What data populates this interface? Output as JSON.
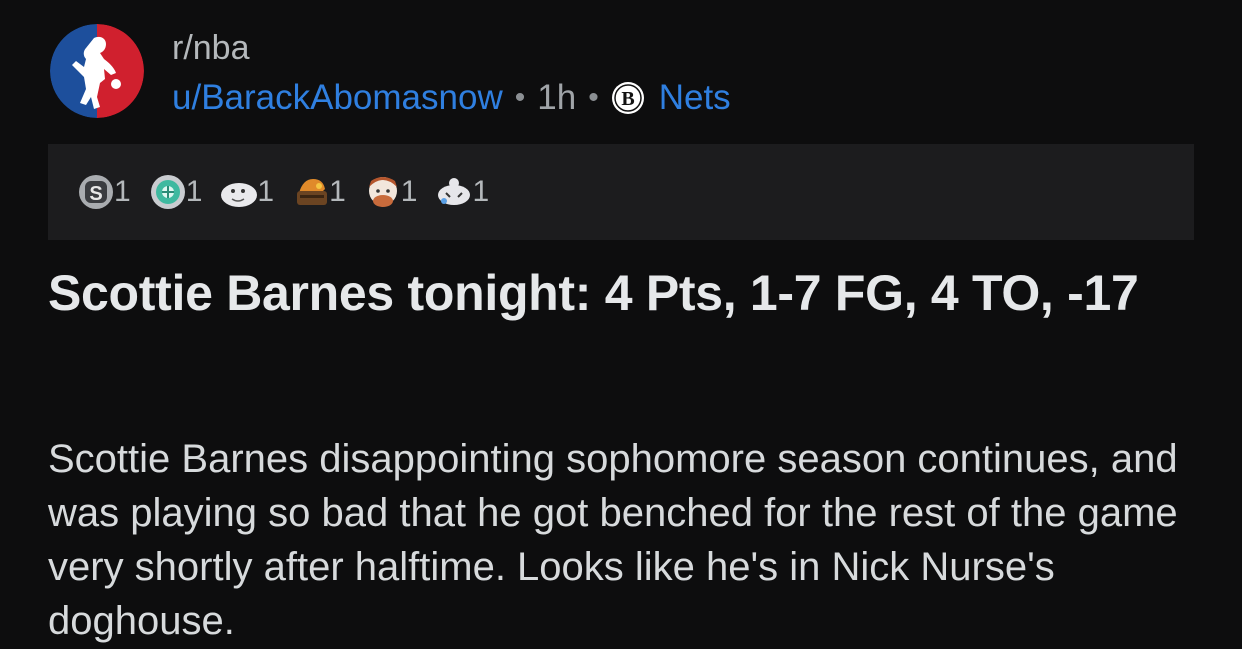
{
  "post": {
    "subreddit": "r/nba",
    "author": "u/BarackAbomasnow",
    "separator": "•",
    "time": "1h",
    "flair": "Nets",
    "title": "Scottie Barnes tonight: 4 Pts, 1-7 FG, 4 TO, -17",
    "body": "Scottie Barnes disappointing sophomore season continues, and was playing so bad that he got benched for the rest of the game very shortly after halftime. Looks like he's in Nick Nurse's doghouse."
  },
  "awards": [
    {
      "icon": "silver-award-icon",
      "count": "1"
    },
    {
      "icon": "helpful-award-icon",
      "count": "1"
    },
    {
      "icon": "upvote-ghost-award-icon",
      "count": "1"
    },
    {
      "icon": "dumpster-fire-award-icon",
      "count": "1"
    },
    {
      "icon": "facepalm-award-icon",
      "count": "1"
    },
    {
      "icon": "tearing-up-award-icon",
      "count": "1"
    }
  ],
  "colors": {
    "background": "#0d0d0e",
    "awards_bar": "#1c1c1e",
    "link_blue": "#2f7fe0",
    "nba_blue": "#1d4f9c",
    "nba_red": "#d0202e"
  }
}
